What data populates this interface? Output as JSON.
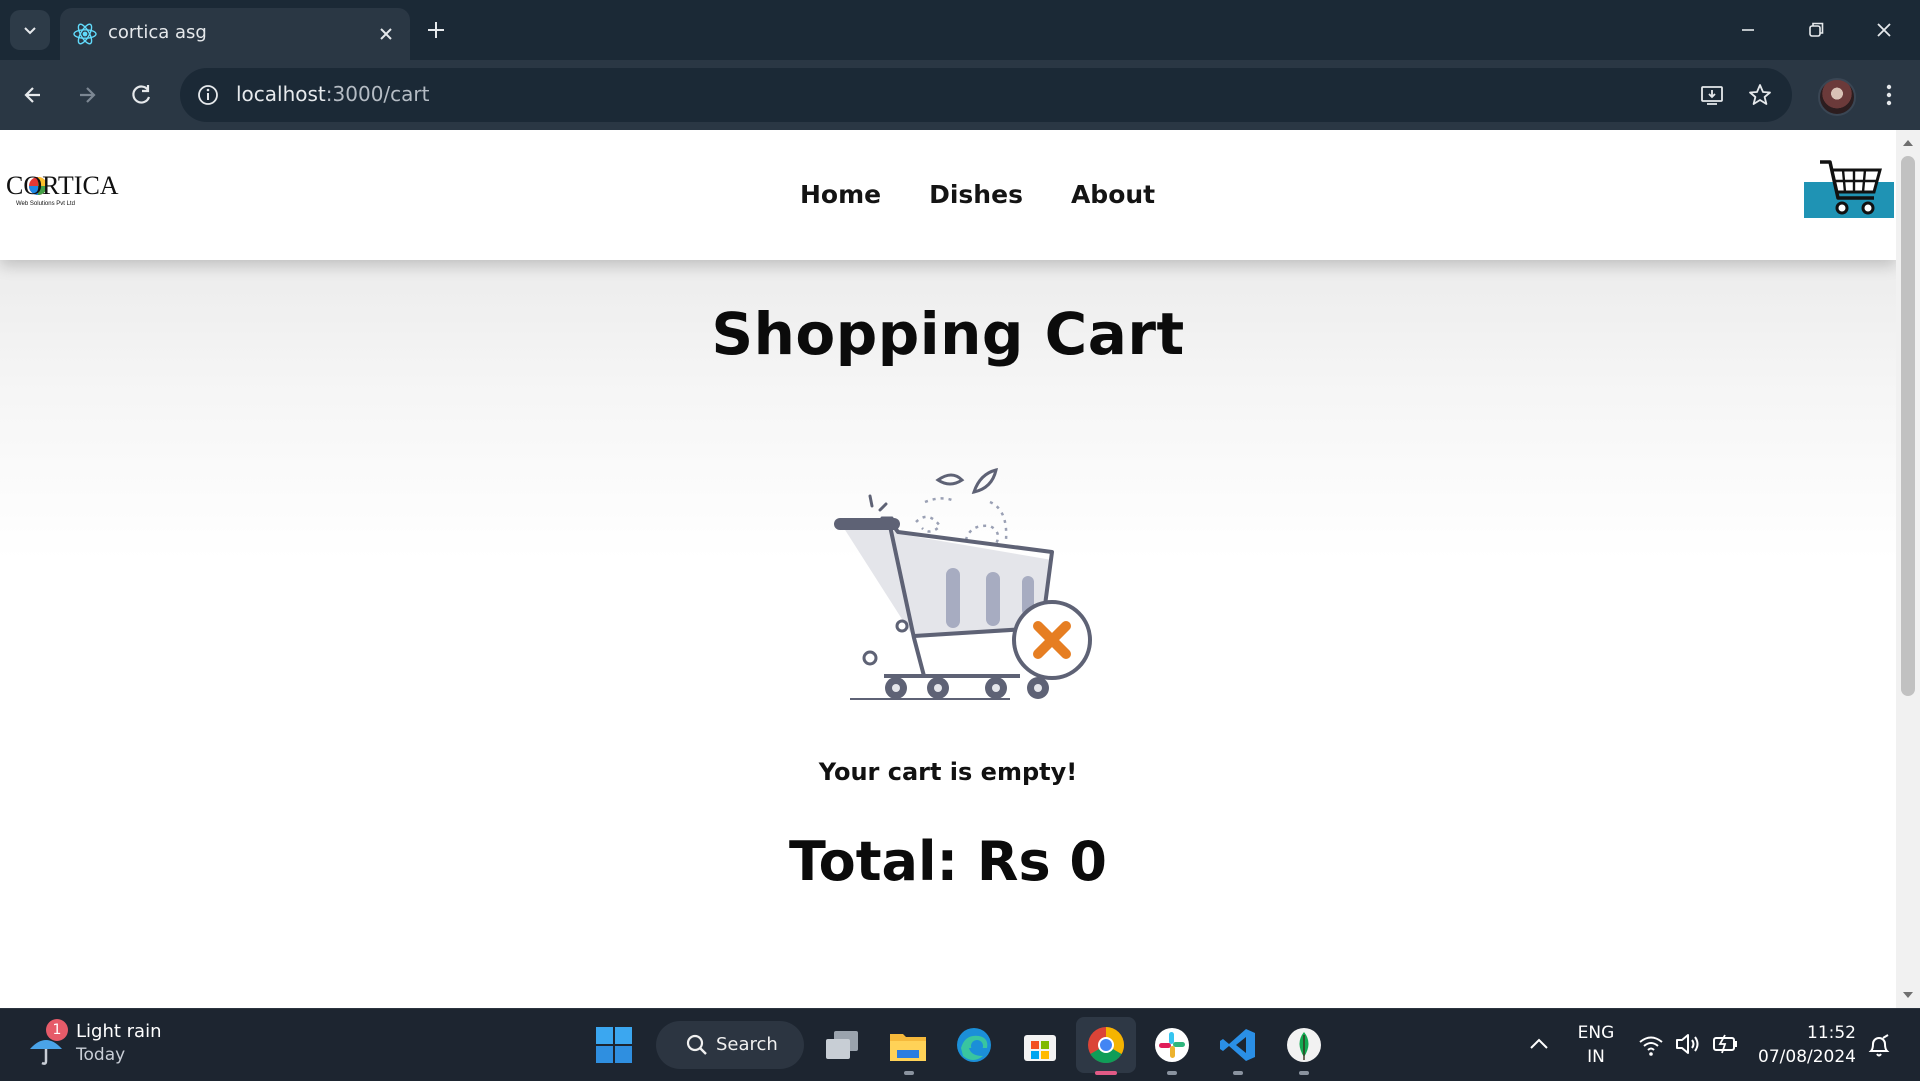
{
  "browser": {
    "tab_title": "cortica asg",
    "url_host": "localhost",
    "url_rest": ":3000/cart"
  },
  "site": {
    "logo_text": "CORTICA",
    "logo_subtitle": "Web Solutions Pvt Ltd",
    "nav": [
      "Home",
      "Dishes",
      "About"
    ]
  },
  "cart": {
    "title": "Shopping Cart",
    "empty_message": "Your cart is empty!",
    "total_label": "Total: Rs 0"
  },
  "taskbar": {
    "weather_title": "Light rain",
    "weather_sub": "Today",
    "weather_badge": "1",
    "search_label": "Search",
    "lang_top": "ENG",
    "lang_bottom": "IN",
    "time": "11:52",
    "date": "07/08/2024"
  },
  "colors": {
    "chrome_dark": "#1b2936",
    "cart_accent": "#1f93b4",
    "remove_x": "#e67e22"
  }
}
